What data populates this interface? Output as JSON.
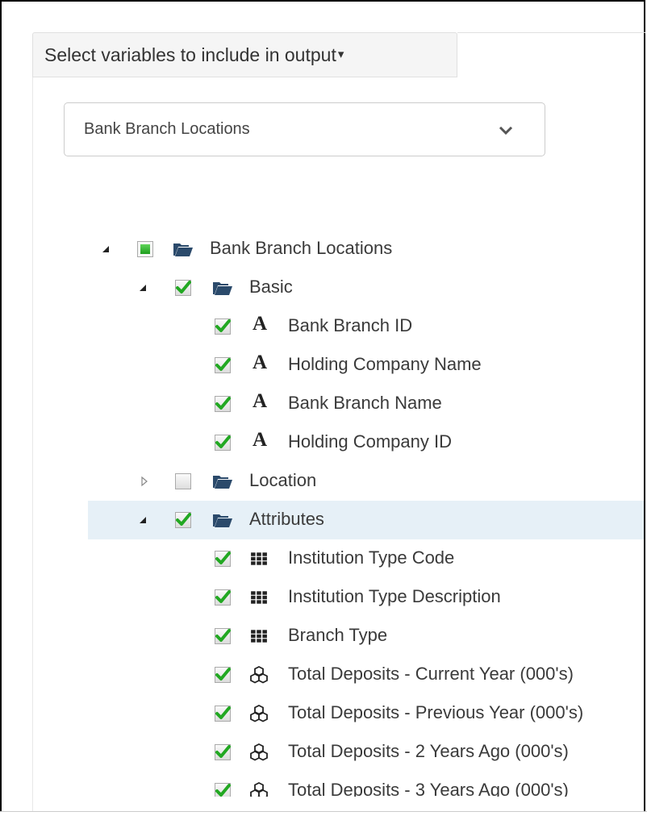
{
  "panel": {
    "title": "Select variables to include in output",
    "caret": "▾"
  },
  "dataset_select": {
    "value": "Bank Branch Locations"
  },
  "tree": {
    "root": {
      "label": "Bank Branch Locations",
      "state": "partial",
      "expanded": true
    },
    "basic": {
      "label": "Basic",
      "state": "checked",
      "expanded": true,
      "items": [
        {
          "label": "Bank Branch ID",
          "type": "text",
          "icon": "A"
        },
        {
          "label": "Holding Company Name",
          "type": "text",
          "icon": "A"
        },
        {
          "label": "Bank Branch Name",
          "type": "text",
          "icon": "A"
        },
        {
          "label": "Holding Company ID",
          "type": "text",
          "icon": "A"
        }
      ]
    },
    "location": {
      "label": "Location",
      "state": "unchecked",
      "expanded": false
    },
    "attributes": {
      "label": "Attributes",
      "state": "checked",
      "expanded": true,
      "selected": true,
      "items": [
        {
          "label": "Institution Type Code",
          "type": "categorical"
        },
        {
          "label": "Institution Type Description",
          "type": "categorical"
        },
        {
          "label": "Branch Type",
          "type": "categorical"
        },
        {
          "label": "Total Deposits - Current Year (000's)",
          "type": "numeric"
        },
        {
          "label": "Total Deposits - Previous Year (000's)",
          "type": "numeric"
        },
        {
          "label": "Total Deposits - 2 Years Ago (000's)",
          "type": "numeric"
        },
        {
          "label": "Total Deposits - 3 Years Ago (000's)",
          "type": "numeric"
        }
      ]
    }
  },
  "colors": {
    "check_green": "#22a822",
    "folder": "#2b4a6b",
    "selected_row": "#e6f0f7"
  }
}
